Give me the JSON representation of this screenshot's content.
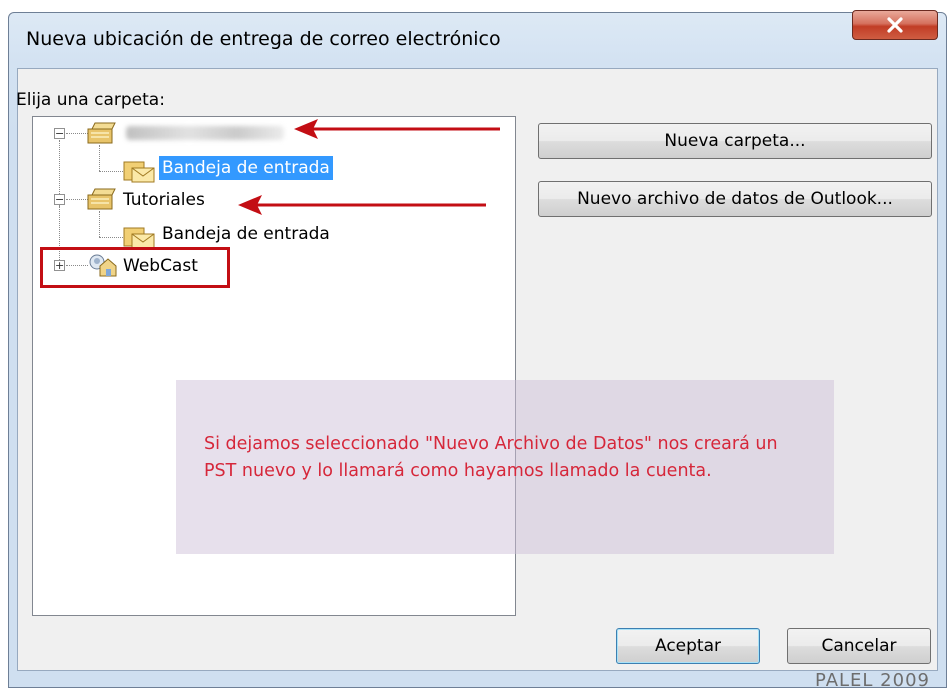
{
  "dialog": {
    "title": "Nueva ubicación de entrega de correo electrónico",
    "close_icon": "close-icon",
    "folder_prompt": "Elija una carpeta:"
  },
  "tree": {
    "nodes": [
      {
        "label": "",
        "icon": "pst-folder-icon",
        "level": 0,
        "expanded": true,
        "note": ""
      },
      {
        "label": "Bandeja de entrada",
        "icon": "inbox-icon",
        "level": 1,
        "selected": true
      },
      {
        "label": "Tutoriales",
        "icon": "pst-folder-icon",
        "level": 0,
        "expanded": true
      },
      {
        "label": "Bandeja de entrada",
        "icon": "inbox-icon",
        "level": 1,
        "selected": false
      },
      {
        "label": "WebCast",
        "icon": "exchange-mailbox-icon",
        "level": 0,
        "expanded": false
      }
    ]
  },
  "buttons": {
    "new_folder": "Nueva carpeta...",
    "new_data_file": "Nuevo archivo de datos de Outlook...",
    "ok": "Aceptar",
    "cancel": "Cancelar"
  },
  "annotation": {
    "text": "Si dejamos seleccionado \"Nuevo Archivo de Datos\" nos creará un PST nuevo y lo llamará como hayamos llamado la cuenta.",
    "color": "#d6273a"
  },
  "watermark": "PALEL 2009",
  "colors": {
    "selection": "#3399ff",
    "annotation_red": "#c30e14"
  }
}
